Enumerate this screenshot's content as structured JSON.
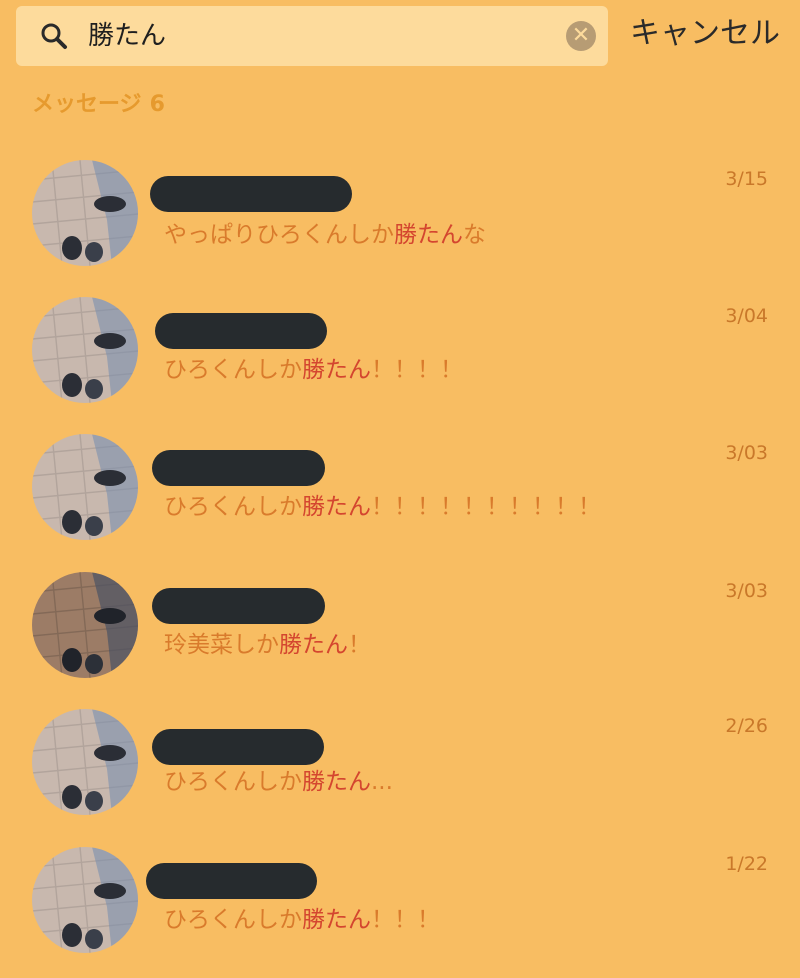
{
  "search": {
    "query": "勝たん",
    "clear_icon": "clear-icon",
    "search_icon": "search-icon"
  },
  "cancel_label": "キャンセル",
  "section": {
    "label": "メッセージ",
    "count": "6"
  },
  "colors": {
    "background": "#F8BD62",
    "search_bg": "#FDDB9C",
    "highlight": "#D4462F",
    "text": "#D97B2C"
  },
  "results": [
    {
      "date": "3/15",
      "pre": "やっぱりひろくんしか",
      "hl": "勝たん",
      "post": "な"
    },
    {
      "date": "3/04",
      "pre": "ひろくんしか",
      "hl": "勝たん",
      "post": "！！！！"
    },
    {
      "date": "3/03",
      "pre": "ひろくんしか",
      "hl": "勝たん",
      "post": "！！！！！！！！！！"
    },
    {
      "date": "3/03",
      "pre": "玲美菜しか",
      "hl": "勝たん",
      "post": "！"
    },
    {
      "date": "2/26",
      "pre": "ひろくんしか",
      "hl": "勝たん",
      "post": "..."
    },
    {
      "date": "1/22",
      "pre": "ひろくんしか",
      "hl": "勝たん",
      "post": "！！！"
    }
  ]
}
